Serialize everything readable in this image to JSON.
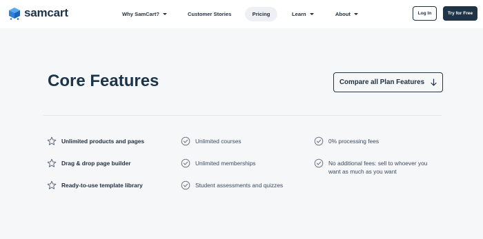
{
  "brand": {
    "name": "samcart"
  },
  "nav": {
    "why": "Why SamCart?",
    "stories": "Customer Stories",
    "pricing": "Pricing",
    "learn": "Learn",
    "about": "About",
    "login": "Log In",
    "try": "Try for Free"
  },
  "main": {
    "title": "Core Features",
    "compare_label": "Compare all Plan Features"
  },
  "features": {
    "col1": [
      {
        "label": "Unlimited products and pages",
        "icon": "star-icon"
      },
      {
        "label": "Drag & drop page builder",
        "icon": "star-icon"
      },
      {
        "label": "Ready-to-use template library",
        "icon": "star-icon"
      }
    ],
    "col2": [
      {
        "label": "Unlimited courses",
        "icon": "check-circle-icon"
      },
      {
        "label": "Unlimited memberships",
        "icon": "check-circle-icon"
      },
      {
        "label": "Student assessments and quizzes",
        "icon": "check-circle-icon"
      }
    ],
    "col3": [
      {
        "label": "0% processing fees",
        "icon": "check-circle-icon"
      },
      {
        "label": "No additional fees: sell to whoever you want as much as you want",
        "icon": "check-circle-icon"
      }
    ]
  },
  "colors": {
    "brand_blue": "#3b8fe0",
    "dark_navy": "#1f3447",
    "background": "#f6f7f9"
  }
}
